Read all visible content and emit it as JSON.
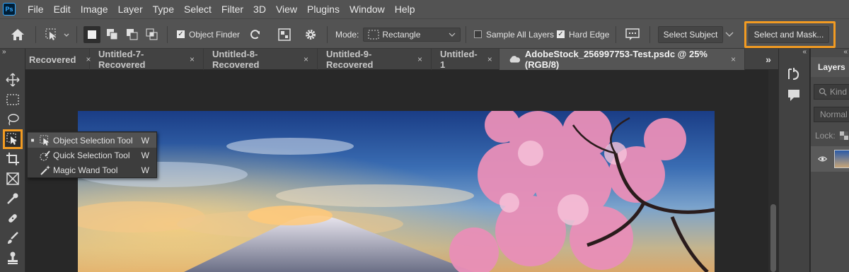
{
  "app": {
    "logo": "Ps"
  },
  "menu": [
    "File",
    "Edit",
    "Image",
    "Layer",
    "Type",
    "Select",
    "Filter",
    "3D",
    "View",
    "Plugins",
    "Window",
    "Help"
  ],
  "options": {
    "object_finder_label": "Object Finder",
    "object_finder_checked": true,
    "mode_label": "Mode:",
    "mode_value": "Rectangle",
    "sample_all_layers_label": "Sample All Layers",
    "sample_all_layers_checked": false,
    "hard_edge_label": "Hard Edge",
    "hard_edge_checked": true,
    "select_subject_label": "Select Subject",
    "select_and_mask_label": "Select and Mask..."
  },
  "tabs": [
    {
      "label": "Recovered",
      "close": "×"
    },
    {
      "label": "Untitled-7-Recovered",
      "close": "×"
    },
    {
      "label": "Untitled-8-Recovered",
      "close": "×"
    },
    {
      "label": "Untitled-9-Recovered",
      "close": "×"
    },
    {
      "label": "Untitled-1",
      "close": "×"
    },
    {
      "label": "AdobeStock_256997753-Test.psdc @ 25% (RGB/8)",
      "close": "×"
    }
  ],
  "tab_overflow": "»",
  "toolbar_collapse": "»",
  "flyout": [
    {
      "label": "Object Selection Tool",
      "key": "W",
      "current": true
    },
    {
      "label": "Quick Selection Tool",
      "key": "W",
      "current": false
    },
    {
      "label": "Magic Wand Tool",
      "key": "W",
      "current": false
    }
  ],
  "right_panel": {
    "collapse": "«",
    "expand": "«",
    "tab_label": "Layers",
    "search_placeholder": "Kind",
    "blend_mode": "Normal",
    "lock_label": "Lock:"
  },
  "colors": {
    "accent": "#f29b22",
    "ps_blue": "#31a8ff"
  }
}
